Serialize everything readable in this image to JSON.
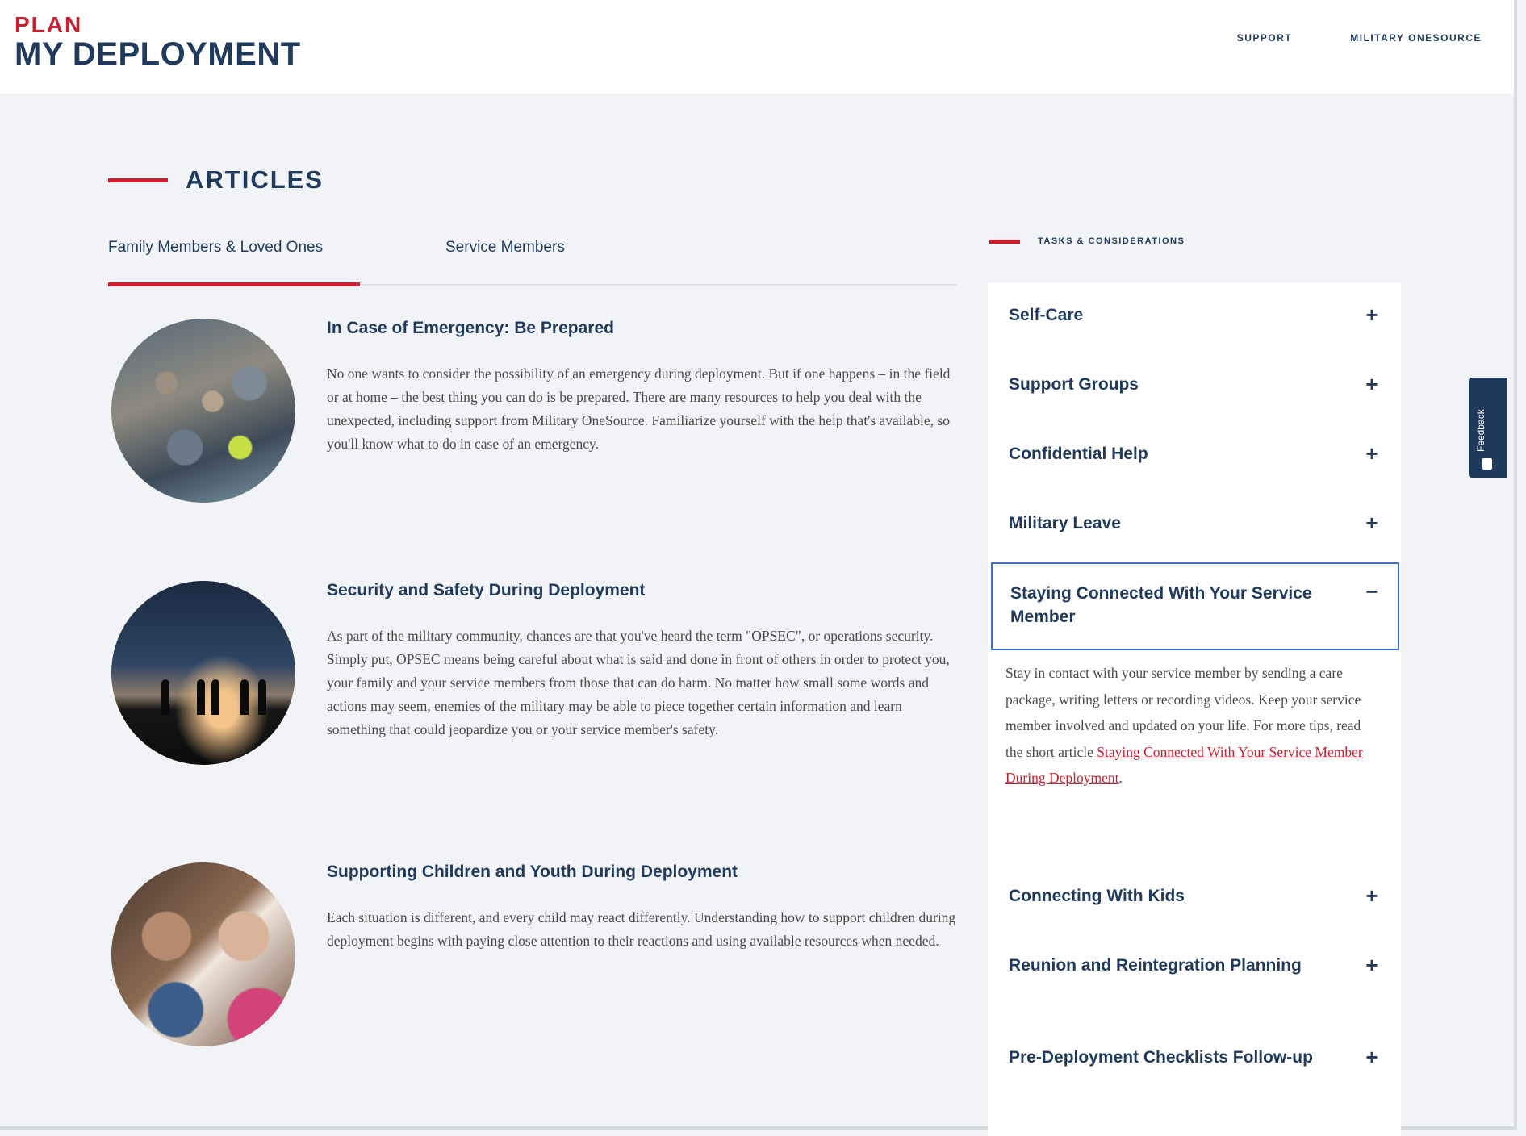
{
  "header": {
    "logo_line1": "PLAN",
    "logo_line2": "MY DEPLOYMENT",
    "nav": [
      "SUPPORT",
      "MILITARY ONESOURCE"
    ]
  },
  "main": {
    "section_title": "ARTICLES",
    "tabs": [
      {
        "label": "Family Members & Loved Ones",
        "active": true
      },
      {
        "label": "Service Members",
        "active": false
      }
    ],
    "articles": [
      {
        "title": "In Case of Emergency: Be Prepared",
        "text": "No one wants to consider the possibility of an emergency during deployment. But if one happens – in the field or at home – the best thing you can do is be prepared. There are many resources to help you deal with the unexpected, including support from Military OneSource. Familiarize yourself with the help that's available, so you'll know what to do in case of an emergency."
      },
      {
        "title": "Security and Safety During Deployment",
        "text": "As part of the military community, chances are that you've heard the term \"OPSEC\", or operations security. Simply put, OPSEC means being careful about what is said and done in front of others in order to protect you, your family and your service members from those that can do harm. No matter how small some words and actions may seem, enemies of the military may be able to piece together certain information and learn something that could jeopardize you or your service member's safety."
      },
      {
        "title": "Supporting Children and Youth During Deployment",
        "text": "Each situation is different, and every child may react differently. Understanding how to support children during deployment begins with paying close attention to their reactions and using available resources when needed."
      }
    ]
  },
  "sidebar": {
    "heading": "TASKS & CONSIDERATIONS",
    "items": [
      {
        "title": "Self-Care",
        "icon": "+"
      },
      {
        "title": "Support Groups",
        "icon": "+"
      },
      {
        "title": "Confidential Help",
        "icon": "+"
      },
      {
        "title": "Military Leave",
        "icon": "+"
      },
      {
        "title": "Staying Connected With Your Service Member",
        "icon": "−"
      },
      {
        "title": "Connecting With Kids",
        "icon": "+"
      },
      {
        "title": "Reunion and Reintegration Planning",
        "icon": "+"
      },
      {
        "title": "Pre-Deployment Checklists Follow-up",
        "icon": "+"
      }
    ],
    "open_content": {
      "text": "Stay in contact with your service member by sending a care package, writing letters or recording videos. Keep your service member involved and updated on your life. For more tips, read the short article ",
      "link": "Staying Connected With Your Service Member During Deployment",
      "after": "."
    }
  },
  "feedback": {
    "label": "Feedback",
    "icon": "feedback-icon"
  },
  "colors": {
    "brand_red": "#c8202f",
    "brand_navy": "#1f3a5c",
    "focus_blue": "#3a6fd8"
  }
}
